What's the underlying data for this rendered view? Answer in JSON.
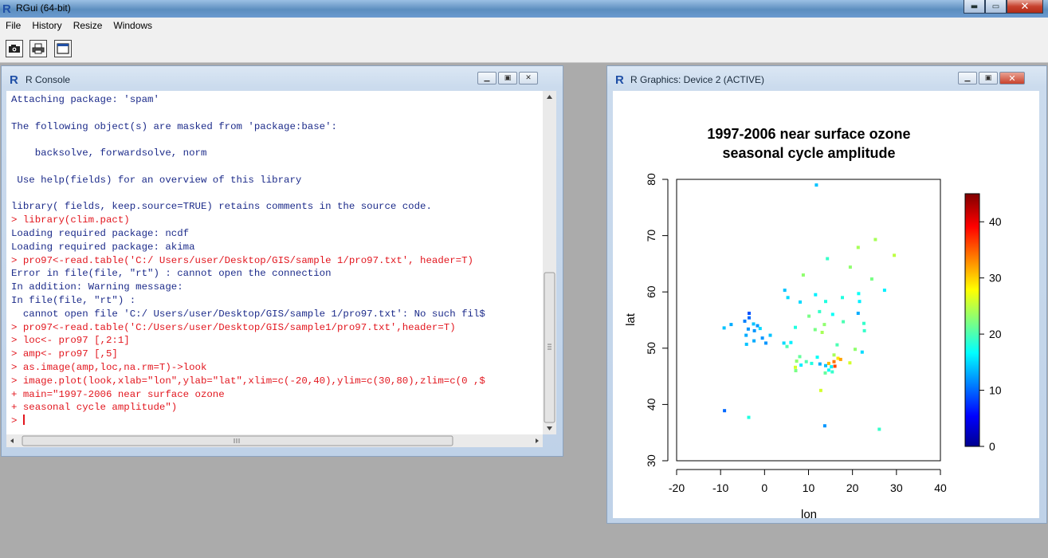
{
  "app": {
    "title": "RGui (64-bit)",
    "menus": [
      "File",
      "History",
      "Resize",
      "Windows"
    ],
    "toolbar": [
      {
        "name": "open-script-icon"
      },
      {
        "name": "print-icon"
      },
      {
        "name": "console-window-icon"
      }
    ]
  },
  "console": {
    "title": "R Console",
    "lines": [
      {
        "t": "Attaching package: 'spam'",
        "k": "out"
      },
      {
        "t": "",
        "k": "out"
      },
      {
        "t": "The following object(s) are masked from 'package:base':",
        "k": "out"
      },
      {
        "t": "",
        "k": "out"
      },
      {
        "t": "    backsolve, forwardsolve, norm",
        "k": "out"
      },
      {
        "t": "",
        "k": "out"
      },
      {
        "t": " Use help(fields) for an overview of this library",
        "k": "out"
      },
      {
        "t": "",
        "k": "out"
      },
      {
        "t": "library( fields, keep.source=TRUE) retains comments in the source code.",
        "k": "out"
      },
      {
        "t": "> library(clim.pact)",
        "k": "in"
      },
      {
        "t": "Loading required package: ncdf",
        "k": "out"
      },
      {
        "t": "Loading required package: akima",
        "k": "out"
      },
      {
        "t": "> pro97<-read.table('C:/ Users/user/Desktop/GIS/sample 1/pro97.txt', header=T)",
        "k": "in"
      },
      {
        "t": "Error in file(file, \"rt\") : cannot open the connection",
        "k": "out"
      },
      {
        "t": "In addition: Warning message:",
        "k": "out"
      },
      {
        "t": "In file(file, \"rt\") :",
        "k": "out"
      },
      {
        "t": "  cannot open file 'C:/ Users/user/Desktop/GIS/sample 1/pro97.txt': No such fil$",
        "k": "out"
      },
      {
        "t": "> pro97<-read.table('C:/Users/user/Desktop/GIS/sample1/pro97.txt',header=T)",
        "k": "in"
      },
      {
        "t": "> loc<- pro97 [,2:1]",
        "k": "in"
      },
      {
        "t": "> amp<- pro97 [,5]",
        "k": "in"
      },
      {
        "t": "> as.image(amp,loc,na.rm=T)->look",
        "k": "in"
      },
      {
        "t": "> image.plot(look,xlab=\"lon\",ylab=\"lat\",xlim=c(-20,40),ylim=c(30,80),zlim=c(0 ,$",
        "k": "in"
      },
      {
        "t": "+ main=\"1997-2006 near surface ozone",
        "k": "in"
      },
      {
        "t": "+ seasonal cycle amplitude\")",
        "k": "in"
      },
      {
        "t": "> ",
        "k": "prompt"
      }
    ]
  },
  "graphics": {
    "title": "R Graphics: Device 2 (ACTIVE)"
  },
  "chart_data": {
    "type": "heatmap",
    "title": "1997-2006 near surface ozone",
    "subtitle": "seasonal cycle amplitude",
    "xlabel": "lon",
    "ylabel": "lat",
    "xlim": [
      -20,
      40
    ],
    "ylim": [
      30,
      80
    ],
    "xticks": [
      -20,
      -10,
      0,
      10,
      20,
      30,
      40
    ],
    "yticks": [
      30,
      40,
      50,
      60,
      70,
      80
    ],
    "zlim": [
      0,
      45
    ],
    "colorbar_ticks": [
      0,
      10,
      20,
      30,
      40
    ],
    "colorscale": "tim.colors (dark blue - cyan - yellow - red)",
    "grid": false,
    "legend": "colorbar-right",
    "cells": [
      {
        "lon": 11.8,
        "lat": 79.0,
        "z": 14
      },
      {
        "lon": 25.2,
        "lat": 69.3,
        "z": 24
      },
      {
        "lon": 29.5,
        "lat": 66.5,
        "z": 25
      },
      {
        "lon": 21.3,
        "lat": 67.9,
        "z": 24
      },
      {
        "lon": 14.3,
        "lat": 65.9,
        "z": 19
      },
      {
        "lon": 19.5,
        "lat": 64.4,
        "z": 23
      },
      {
        "lon": 8.8,
        "lat": 63.0,
        "z": 23
      },
      {
        "lon": 24.4,
        "lat": 62.3,
        "z": 22
      },
      {
        "lon": 4.6,
        "lat": 60.3,
        "z": 14
      },
      {
        "lon": 11.6,
        "lat": 59.5,
        "z": 16
      },
      {
        "lon": 21.4,
        "lat": 59.7,
        "z": 17
      },
      {
        "lon": 27.3,
        "lat": 60.3,
        "z": 16
      },
      {
        "lon": 5.3,
        "lat": 59.0,
        "z": 15
      },
      {
        "lon": 17.7,
        "lat": 59.0,
        "z": 18
      },
      {
        "lon": 8.1,
        "lat": 58.2,
        "z": 15
      },
      {
        "lon": 13.9,
        "lat": 58.3,
        "z": 18
      },
      {
        "lon": 21.6,
        "lat": 58.3,
        "z": 16
      },
      {
        "lon": 12.5,
        "lat": 56.5,
        "z": 19
      },
      {
        "lon": 15.5,
        "lat": 56.0,
        "z": 17
      },
      {
        "lon": 21.3,
        "lat": 56.2,
        "z": 13
      },
      {
        "lon": 10.1,
        "lat": 55.7,
        "z": 22
      },
      {
        "lon": -3.5,
        "lat": 56.2,
        "z": 9
      },
      {
        "lon": -3.5,
        "lat": 55.4,
        "z": 10
      },
      {
        "lon": -4.5,
        "lat": 54.8,
        "z": 11
      },
      {
        "lon": 22.6,
        "lat": 54.4,
        "z": 19
      },
      {
        "lon": 17.9,
        "lat": 54.7,
        "z": 20
      },
      {
        "lon": 13.6,
        "lat": 54.2,
        "z": 23
      },
      {
        "lon": 7.0,
        "lat": 53.7,
        "z": 18
      },
      {
        "lon": -7.6,
        "lat": 54.2,
        "z": 13
      },
      {
        "lon": -9.2,
        "lat": 53.6,
        "z": 14
      },
      {
        "lon": -2.5,
        "lat": 54.3,
        "z": 14
      },
      {
        "lon": -1.6,
        "lat": 54.0,
        "z": 12
      },
      {
        "lon": -1.0,
        "lat": 53.5,
        "z": 15
      },
      {
        "lon": -3.7,
        "lat": 53.4,
        "z": 12
      },
      {
        "lon": 11.5,
        "lat": 53.3,
        "z": 22
      },
      {
        "lon": -2.3,
        "lat": 53.1,
        "z": 12
      },
      {
        "lon": 22.7,
        "lat": 53.1,
        "z": 19
      },
      {
        "lon": 13.1,
        "lat": 52.8,
        "z": 24
      },
      {
        "lon": -4.2,
        "lat": 52.3,
        "z": 13
      },
      {
        "lon": 1.3,
        "lat": 52.3,
        "z": 14
      },
      {
        "lon": -0.5,
        "lat": 51.8,
        "z": 12
      },
      {
        "lon": -2.4,
        "lat": 51.3,
        "z": 13
      },
      {
        "lon": -4.1,
        "lat": 50.7,
        "z": 14
      },
      {
        "lon": 0.3,
        "lat": 50.9,
        "z": 12
      },
      {
        "lon": 4.4,
        "lat": 50.9,
        "z": 15
      },
      {
        "lon": 5.1,
        "lat": 50.3,
        "z": 20
      },
      {
        "lon": 6.0,
        "lat": 51.0,
        "z": 16
      },
      {
        "lon": 16.5,
        "lat": 50.6,
        "z": 20
      },
      {
        "lon": 20.6,
        "lat": 49.8,
        "z": 23
      },
      {
        "lon": 22.2,
        "lat": 49.3,
        "z": 15
      },
      {
        "lon": 8.0,
        "lat": 48.5,
        "z": 21
      },
      {
        "lon": 12.0,
        "lat": 48.4,
        "z": 17
      },
      {
        "lon": 15.8,
        "lat": 48.8,
        "z": 24
      },
      {
        "lon": 16.7,
        "lat": 48.2,
        "z": 29
      },
      {
        "lon": 17.3,
        "lat": 48.0,
        "z": 32
      },
      {
        "lon": 7.3,
        "lat": 47.7,
        "z": 23
      },
      {
        "lon": 9.5,
        "lat": 47.6,
        "z": 20
      },
      {
        "lon": 15.8,
        "lat": 47.6,
        "z": 34
      },
      {
        "lon": 10.7,
        "lat": 47.3,
        "z": 18
      },
      {
        "lon": 14.6,
        "lat": 47.3,
        "z": 31
      },
      {
        "lon": 19.4,
        "lat": 47.4,
        "z": 26
      },
      {
        "lon": 8.3,
        "lat": 47.0,
        "z": 16
      },
      {
        "lon": 12.6,
        "lat": 47.2,
        "z": 13
      },
      {
        "lon": 13.9,
        "lat": 46.9,
        "z": 14
      },
      {
        "lon": 15.2,
        "lat": 46.7,
        "z": 16
      },
      {
        "lon": 7.0,
        "lat": 46.6,
        "z": 26
      },
      {
        "lon": 16.0,
        "lat": 46.8,
        "z": 36
      },
      {
        "lon": 14.6,
        "lat": 46.1,
        "z": 17
      },
      {
        "lon": 13.8,
        "lat": 45.6,
        "z": 21
      },
      {
        "lon": 7.1,
        "lat": 46.0,
        "z": 22
      },
      {
        "lon": 15.4,
        "lat": 45.8,
        "z": 19
      },
      {
        "lon": 12.8,
        "lat": 42.5,
        "z": 26
      },
      {
        "lon": -9.1,
        "lat": 38.9,
        "z": 10
      },
      {
        "lon": -3.6,
        "lat": 37.7,
        "z": 18
      },
      {
        "lon": 13.7,
        "lat": 36.2,
        "z": 12
      },
      {
        "lon": 26.1,
        "lat": 35.6,
        "z": 19
      }
    ]
  }
}
